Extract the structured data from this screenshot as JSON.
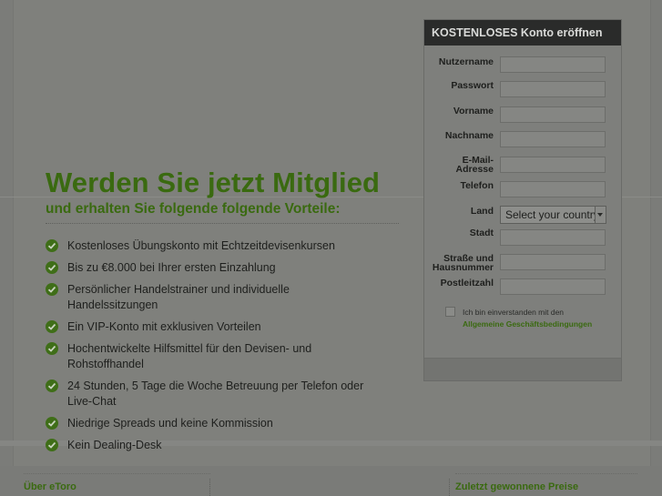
{
  "hero": {
    "title": "Werden Sie jetzt Mitglied",
    "subtitle": "und erhalten Sie folgende folgende Vorteile:"
  },
  "benefits": [
    "Kostenloses Übungskonto mit Echtzeitdevisenkursen",
    "Bis zu €8.000 bei Ihrer ersten Einzahlung",
    "Persönlicher Handelstrainer und individuelle Handelssitzungen",
    "Ein VIP-Konto mit exklusiven Vorteilen",
    "Hochentwickelte Hilfsmittel für den Devisen- und Rohstoffhandel",
    "24 Stunden, 5 Tage die Woche Betreuung per Telefon oder Live-Chat",
    "Niedrige Spreads und keine Kommission",
    "Kein Dealing-Desk"
  ],
  "form": {
    "heading": "KOSTENLOSES Konto eröffnen",
    "fields": {
      "username": "Nutzername",
      "password": "Passwort",
      "firstname": "Vorname",
      "lastname": "Nachname",
      "email": "E-Mail-Adresse",
      "phone": "Telefon",
      "country": "Land",
      "city": "Stadt",
      "street": "Straße und Hausnummer",
      "zip": "Postleitzahl"
    },
    "country_select": "Select your country",
    "agree_text": "Ich bin einverstanden mit den",
    "agree_link": "Allgemeine Geschäftsbedingungen"
  },
  "footer": {
    "left_heading": "Über eToro",
    "right_heading": "Zuletzt gewonnene Preise"
  },
  "colors": {
    "accent_green": "#3a6a10",
    "form_header": "#2a2b2a"
  },
  "icons": {
    "benefit": "check-circle-icon",
    "dropdown": "chevron-down-icon"
  }
}
